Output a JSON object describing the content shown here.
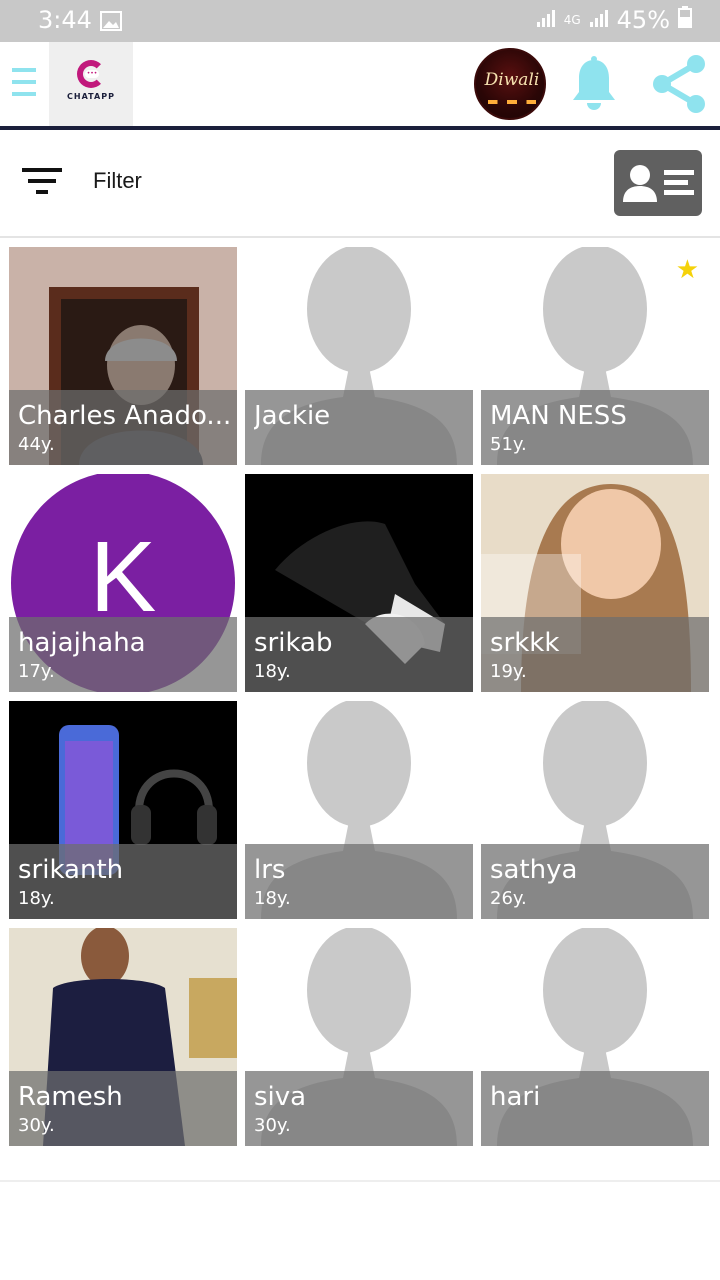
{
  "status_bar": {
    "time": "3:44",
    "network": "4G",
    "battery": "45%"
  },
  "app_bar": {
    "logo_text": "CHATAPP",
    "banner_text": "Diwali",
    "colors": {
      "accent": "#8fe3ee",
      "brand": "#c1187c",
      "divider": "#1b1f3b"
    }
  },
  "filter_bar": {
    "label": "Filter"
  },
  "profiles": [
    {
      "name": "Charles Anado...",
      "age": "44y.",
      "photo": "man-beanie",
      "favorite": false
    },
    {
      "name": "Jackie",
      "age": "",
      "photo": "placeholder",
      "favorite": false
    },
    {
      "name": "MAN NESS",
      "age": "51y.",
      "photo": "placeholder",
      "favorite": true
    },
    {
      "name": "hajajhaha",
      "age": "17y.",
      "photo": "letter-k",
      "favorite": false
    },
    {
      "name": "srikab",
      "age": "18y.",
      "photo": "sneaker",
      "favorite": false
    },
    {
      "name": "srkkk",
      "age": "19y.",
      "photo": "baby",
      "favorite": false
    },
    {
      "name": "srikanth",
      "age": "18y.",
      "photo": "phone-headphones",
      "favorite": false
    },
    {
      "name": "lrs",
      "age": "18y.",
      "photo": "placeholder",
      "favorite": false
    },
    {
      "name": "sathya",
      "age": "26y.",
      "photo": "placeholder",
      "favorite": false
    },
    {
      "name": "Ramesh",
      "age": "30y.",
      "photo": "man-standing",
      "favorite": false
    },
    {
      "name": "siva",
      "age": "30y.",
      "photo": "placeholder",
      "favorite": false
    },
    {
      "name": "hari",
      "age": "",
      "photo": "placeholder",
      "favorite": false
    }
  ],
  "letter_avatar": "K"
}
